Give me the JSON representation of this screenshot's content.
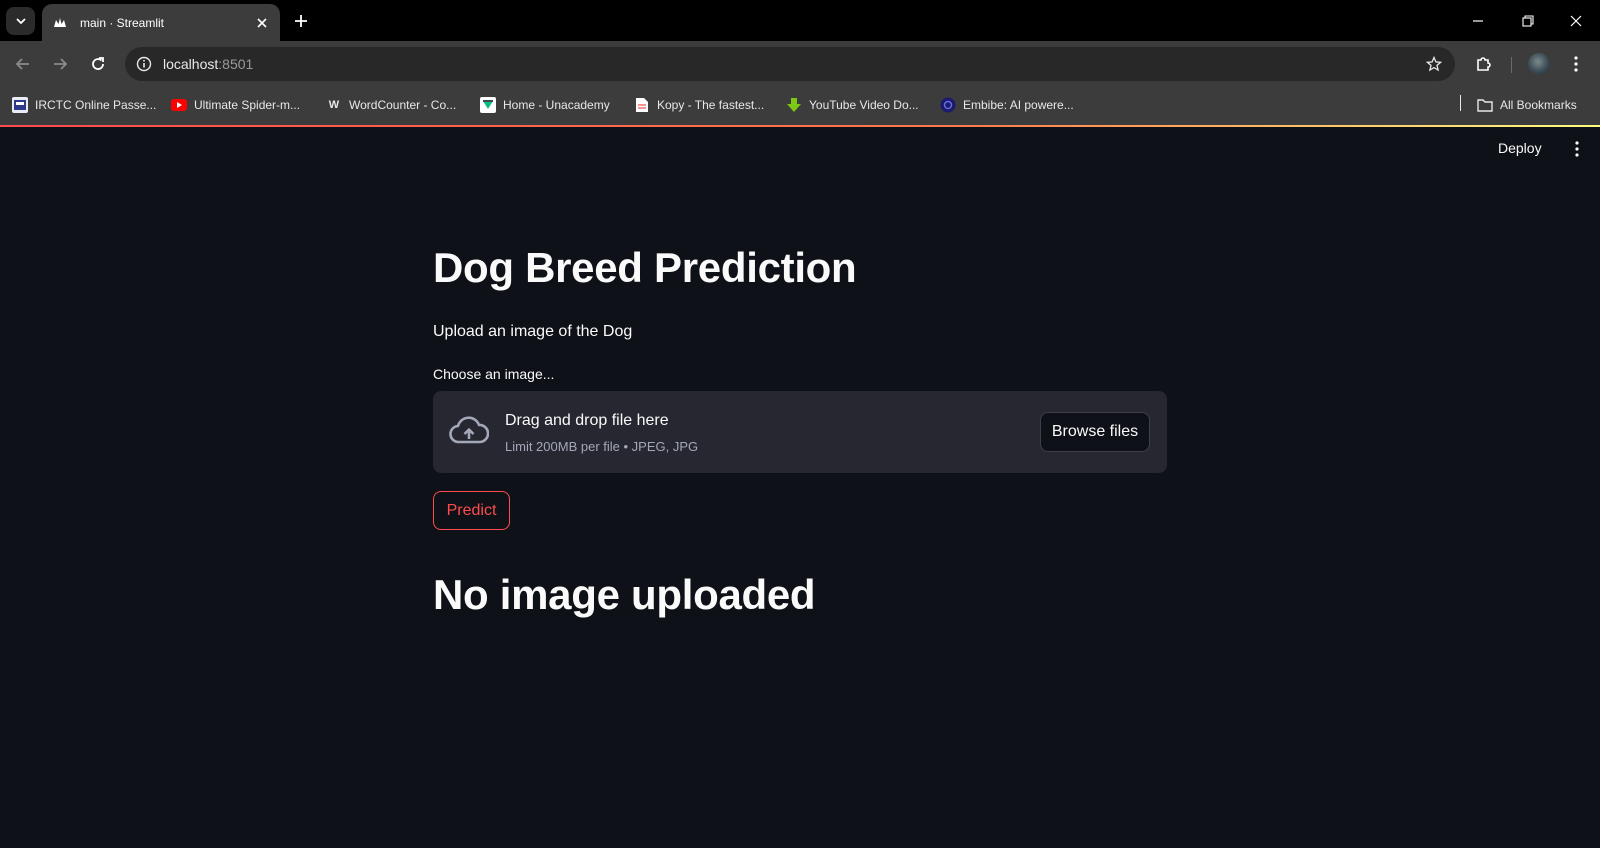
{
  "browser": {
    "tab_title": "main · Streamlit",
    "url_host": "localhost",
    "url_port": ":8501",
    "bookmarks": [
      {
        "label": "IRCTC Online Passe...",
        "icon": "irctc-icon",
        "color": "#2d3a8c"
      },
      {
        "label": "Ultimate Spider-m...",
        "icon": "youtube-icon",
        "color": "#ff0000"
      },
      {
        "label": "WordCounter - Co...",
        "icon": "wordcounter-icon",
        "color": "#e8e8e8"
      },
      {
        "label": "Home - Unacademy",
        "icon": "unacademy-icon",
        "color": "#08bd80"
      },
      {
        "label": "Kopy - The fastest...",
        "icon": "document-icon",
        "color": "#ffffff"
      },
      {
        "label": "YouTube Video Do...",
        "icon": "download-icon",
        "color": "#7cc814"
      },
      {
        "label": "Embibe: AI powere...",
        "icon": "embibe-icon",
        "color": "#1a1a6e"
      }
    ],
    "all_bookmarks_label": "All Bookmarks"
  },
  "app": {
    "deploy_label": "Deploy",
    "title": "Dog Breed Prediction",
    "subtitle": "Upload an image of the Dog",
    "uploader": {
      "label": "Choose an image...",
      "drag_text": "Drag and drop file here",
      "limit_text": "Limit 200MB per file • JPEG, JPG",
      "browse_label": "Browse files"
    },
    "predict_label": "Predict",
    "status_text": "No image uploaded"
  },
  "colors": {
    "background": "#0e1117",
    "text": "#fafafa",
    "primary": "#ff4b4b",
    "secondary_bg": "#262730"
  }
}
